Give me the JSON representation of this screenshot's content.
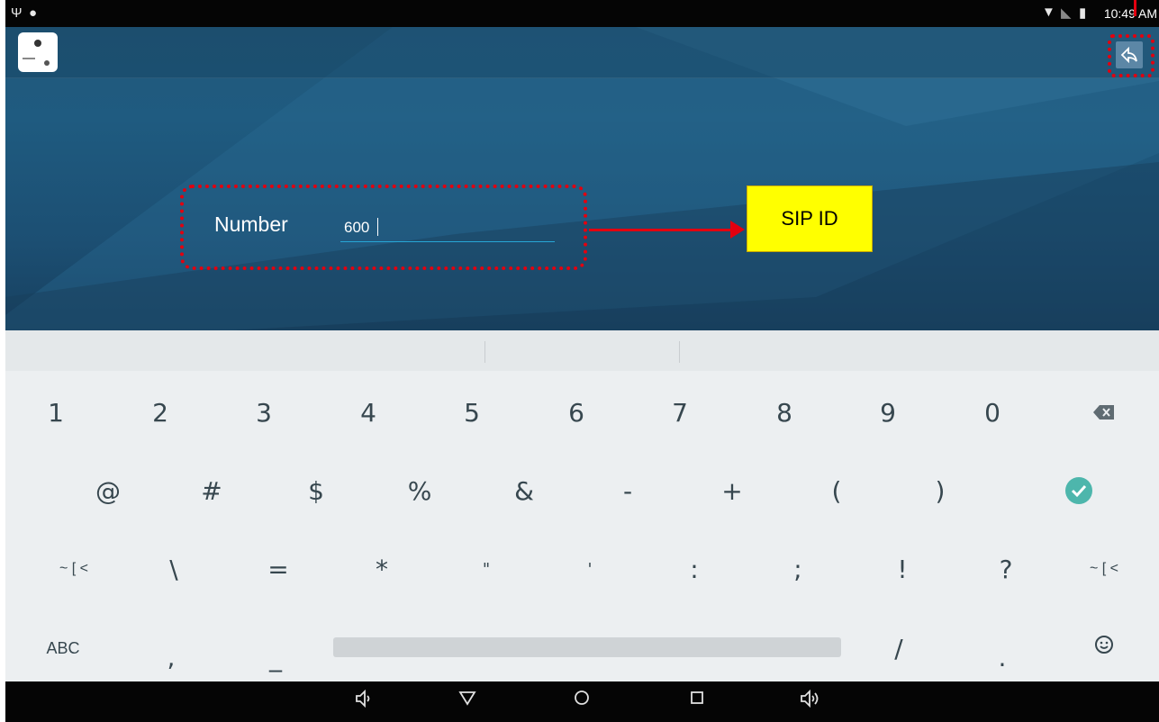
{
  "status_bar": {
    "left_icons": [
      "usb-icon",
      "android-debug-icon"
    ],
    "right_icons": [
      "wifi-icon",
      "no-sim-icon",
      "battery-icon"
    ],
    "time": "10:49 AM"
  },
  "app": {
    "field_label": "Number",
    "field_value": "600"
  },
  "annotation": {
    "callout": "SIP ID"
  },
  "keyboard": {
    "row1": [
      "1",
      "2",
      "3",
      "4",
      "5",
      "6",
      "7",
      "8",
      "9",
      "0"
    ],
    "row2": [
      "@",
      "#",
      "$",
      "%",
      "&",
      "-",
      "+",
      "(",
      ")"
    ],
    "row3": [
      "~ [ <",
      "\\",
      "=",
      "*",
      "\"",
      "'",
      ":",
      ";",
      "!",
      "?",
      "~ [ <"
    ],
    "row4": [
      "ABC",
      ",",
      "_",
      "/",
      "."
    ],
    "special": {
      "backspace": "backspace-icon",
      "done": "done-check-icon",
      "emoji": "emoji-icon"
    }
  },
  "nav_bar": {
    "buttons": [
      "volume-down-icon",
      "back-icon",
      "home-icon",
      "recents-icon",
      "volume-up-icon"
    ]
  },
  "colors": {
    "annotation_red": "#e3000f",
    "callout_yellow": "#ffff00",
    "done_green": "#4db6ac",
    "field_underline": "#27a6d6"
  }
}
